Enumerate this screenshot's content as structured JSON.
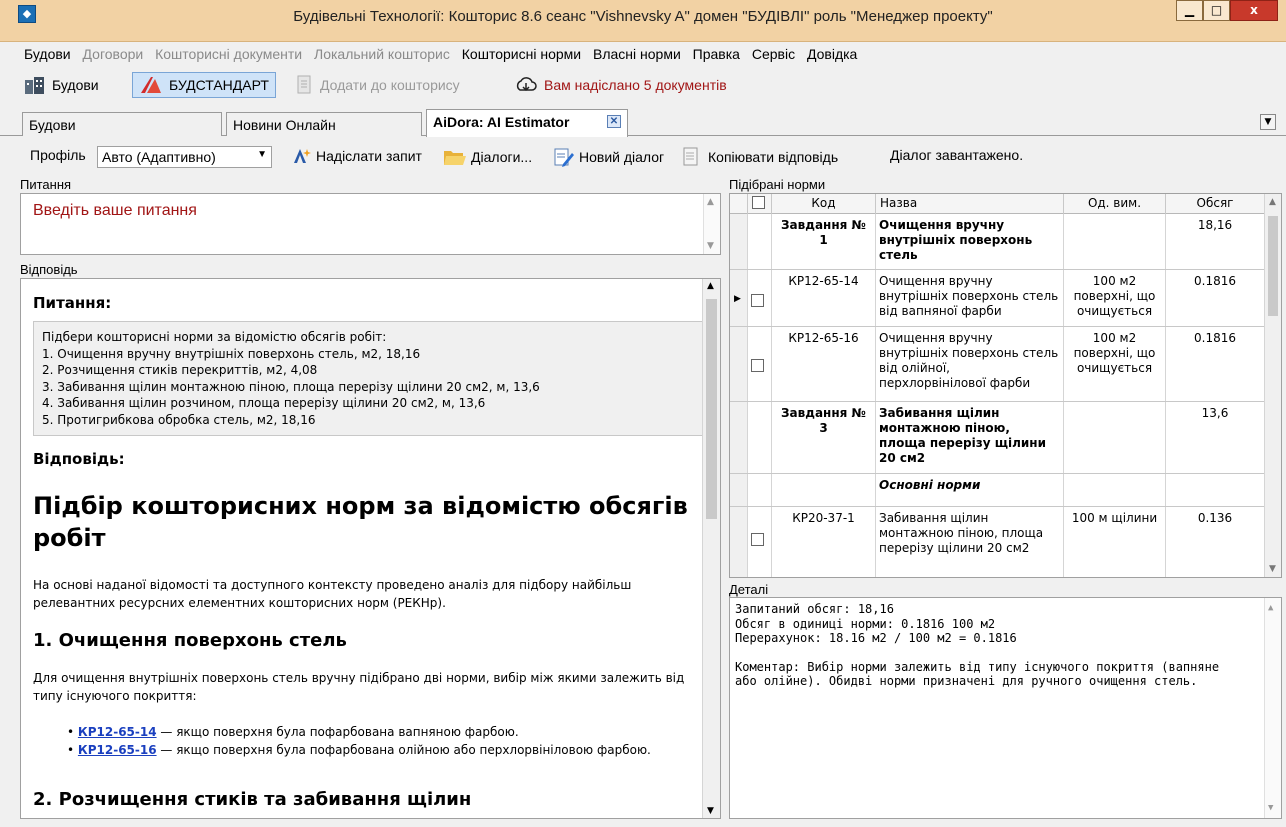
{
  "window": {
    "title": "Будівельні Технології: Кошторис 8.6    сеанс \"Vishnevsky A\"  домен \"БУДІВЛІ\" роль \"Менеджер проекту\"",
    "min": "▁",
    "max": "□",
    "close": "x"
  },
  "menu": {
    "items": [
      "Будови",
      "Договори",
      "Кошторисні документи",
      "Локальний кошторис",
      "Кошторисні норми",
      "Власні норми",
      "Правка",
      "Сервіс",
      "Довідка"
    ]
  },
  "toolbar": {
    "budovy": "Будови",
    "budstandart": "БУДСТАНДАРТ",
    "add_to_estimate": "Додати до кошторису",
    "notice": "Вам надіслано 5 документів"
  },
  "tabs": [
    {
      "label": "Будови"
    },
    {
      "label": "Новини Онлайн"
    },
    {
      "label": "AiDora: AI Estimator"
    }
  ],
  "aidora": {
    "profile_label": "Профіль",
    "profile_value": "Авто (Адаптивно)",
    "send": "Надіслати запит",
    "dialogs": "Діалоги...",
    "new_dialog": "Новий діалог",
    "copy": "Копіювати відповідь",
    "status": "Діалог завантажено."
  },
  "question": {
    "label": "Питання",
    "placeholder": "Введіть ваше питання"
  },
  "answer": {
    "label": "Відповідь",
    "q_heading": "Питання:",
    "q_lines": [
      "Підбери кошторисні норми за відомістю обсягів робіт:",
      "1. Очищення вручну внутрішніх поверхонь стель, м2, 18,16",
      "2. Розчищення стиків перекриттів, м2, 4,08",
      "3. Забивання щілин монтажною піною, площа перерізу щілини 20 см2, м, 13,6",
      "4. Забивання щілин розчином, площа перерізу щілини 20 см2, м, 13,6",
      "5. Протигрибкова обробка стель, м2, 18,16"
    ],
    "a_heading": "Відповідь:",
    "h1": "Підбір кошторисних норм за відомістю обсягів робіт",
    "intro": "На основі наданої відомості та доступного контексту проведено аналіз для підбору найбільш релевантних ресурсних елементних кошторисних норм (РЕКНр).",
    "h2_1": "1. Очищення поверхонь стель",
    "p1": "Для очищення внутрішніх поверхонь стель вручну підібрано дві норми, вибір між якими залежить від типу існуючого покриття:",
    "bullets": [
      {
        "code": "КР12-65-14",
        "text": " — якщо поверхня була пофарбована вапняною фарбою."
      },
      {
        "code": "КР12-65-16",
        "text": " — якщо поверхня була пофарбована олійною або перхлорвініловою фарбою."
      }
    ],
    "h2_2": "2. Розчищення стиків та забивання щілин"
  },
  "norms": {
    "label": "Підібрані норми",
    "headers": {
      "code": "Код",
      "name": "Назва",
      "unit": "Од. вим.",
      "volume": "Обсяг"
    },
    "rows": [
      {
        "code": "Завдання № 1",
        "name": "Очищення вручну внутрішніх поверхонь стель",
        "unit": "",
        "volume": "18,16",
        "type": "task"
      },
      {
        "code": "КР12-65-14",
        "name": "Очищення вручну внутрішніх поверхонь стель від вапняної фарби",
        "unit": "100 м2 поверхні, що очищується",
        "volume": "0.1816",
        "type": "norm"
      },
      {
        "code": "КР12-65-16",
        "name": "Очищення вручну внутрішніх поверхонь стель від олійної, перхлорвінілової фарби",
        "unit": "100 м2 поверхні, що очищується",
        "volume": "0.1816",
        "type": "norm"
      },
      {
        "code": "Завдання № 3",
        "name": "Забивання щілин монтажною піною, площа перерізу щілини 20 см2",
        "unit": "",
        "volume": "13,6",
        "type": "task"
      },
      {
        "code": "",
        "name": "Основні норми",
        "unit": "",
        "volume": "",
        "type": "group"
      },
      {
        "code": "КР20-37-1",
        "name": "Забивання щілин монтажною піною, площа перерізу щілини 20 см2",
        "unit": "100 м щілини",
        "volume": "0.136",
        "type": "norm"
      }
    ]
  },
  "details": {
    "label": "Деталі",
    "lines": [
      "Запитаний обсяг: 18,16",
      "Обсяг в одиниці норми: 0.1816 100 м2",
      "Перерахунок: 18.16 м2 / 100 м2 = 0.1816",
      "",
      "Коментар: Вибір норми залежить від типу існуючого покриття (вапняне",
      "або олійне). Обидві норми призначені для ручного очищення стель."
    ]
  },
  "colors": {
    "title_bg": "#f2d2a4",
    "accent_red": "#a11515",
    "link": "#1a3fbf"
  }
}
